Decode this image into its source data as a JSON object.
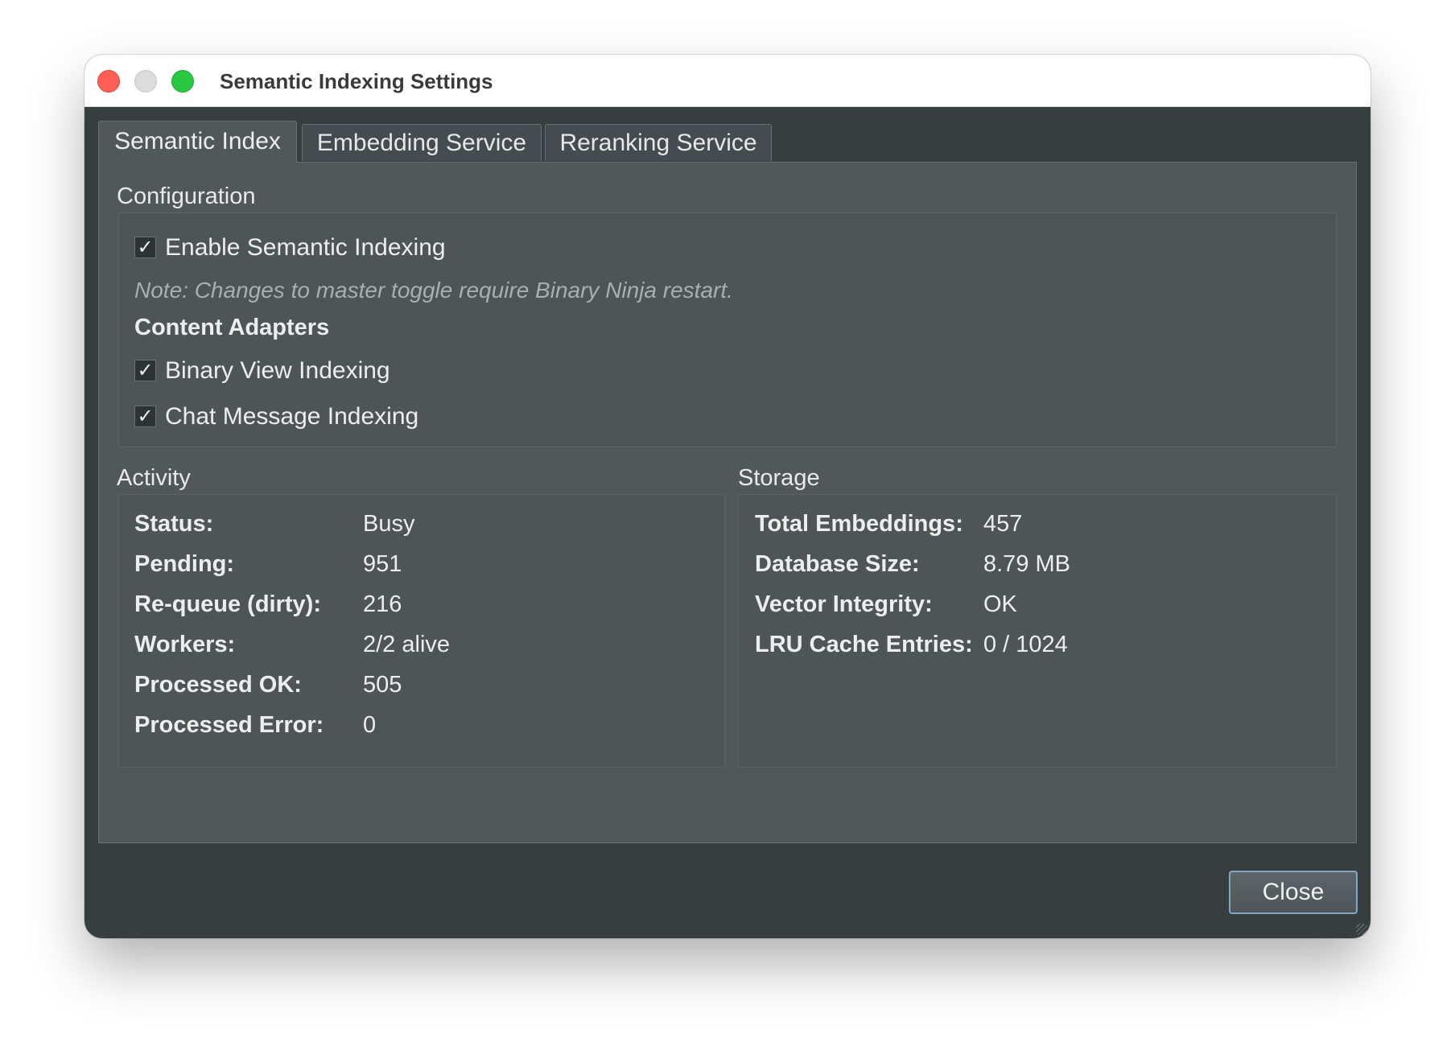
{
  "window": {
    "title": "Semantic Indexing Settings"
  },
  "tabs": [
    {
      "label": "Semantic Index",
      "active": true
    },
    {
      "label": "Embedding Service",
      "active": false
    },
    {
      "label": "Reranking Service",
      "active": false
    }
  ],
  "configuration": {
    "title": "Configuration",
    "enable_semantic_indexing": {
      "label": "Enable Semantic Indexing",
      "checked": true
    },
    "note": "Note: Changes to master toggle require Binary Ninja restart.",
    "content_adapters_title": "Content Adapters",
    "binary_view_indexing": {
      "label": "Binary View Indexing",
      "checked": true
    },
    "chat_message_indexing": {
      "label": "Chat Message Indexing",
      "checked": true
    }
  },
  "activity": {
    "title": "Activity",
    "rows": [
      {
        "key": "Status:",
        "value": "Busy"
      },
      {
        "key": "Pending:",
        "value": "951"
      },
      {
        "key": "Re-queue (dirty):",
        "value": "216"
      },
      {
        "key": "Workers:",
        "value": "2/2 alive"
      },
      {
        "key": "Processed OK:",
        "value": "505"
      },
      {
        "key": "Processed Error:",
        "value": "0"
      }
    ]
  },
  "storage": {
    "title": "Storage",
    "rows": [
      {
        "key": "Total Embeddings:",
        "value": "457"
      },
      {
        "key": "Database Size:",
        "value": "8.79 MB"
      },
      {
        "key": "Vector Integrity:",
        "value": "OK"
      },
      {
        "key": "LRU Cache Entries:",
        "value": "0 / 1024"
      }
    ]
  },
  "footer": {
    "close_label": "Close"
  },
  "icons": {
    "checkmark_glyph": "✓"
  },
  "colors": {
    "window_bg": "#383e40",
    "panel_bg": "#525859",
    "close_traffic": "#fe5f57",
    "min_traffic": "#dcdcdc",
    "max_traffic": "#28c840",
    "focus_border": "#7ea8c4"
  }
}
